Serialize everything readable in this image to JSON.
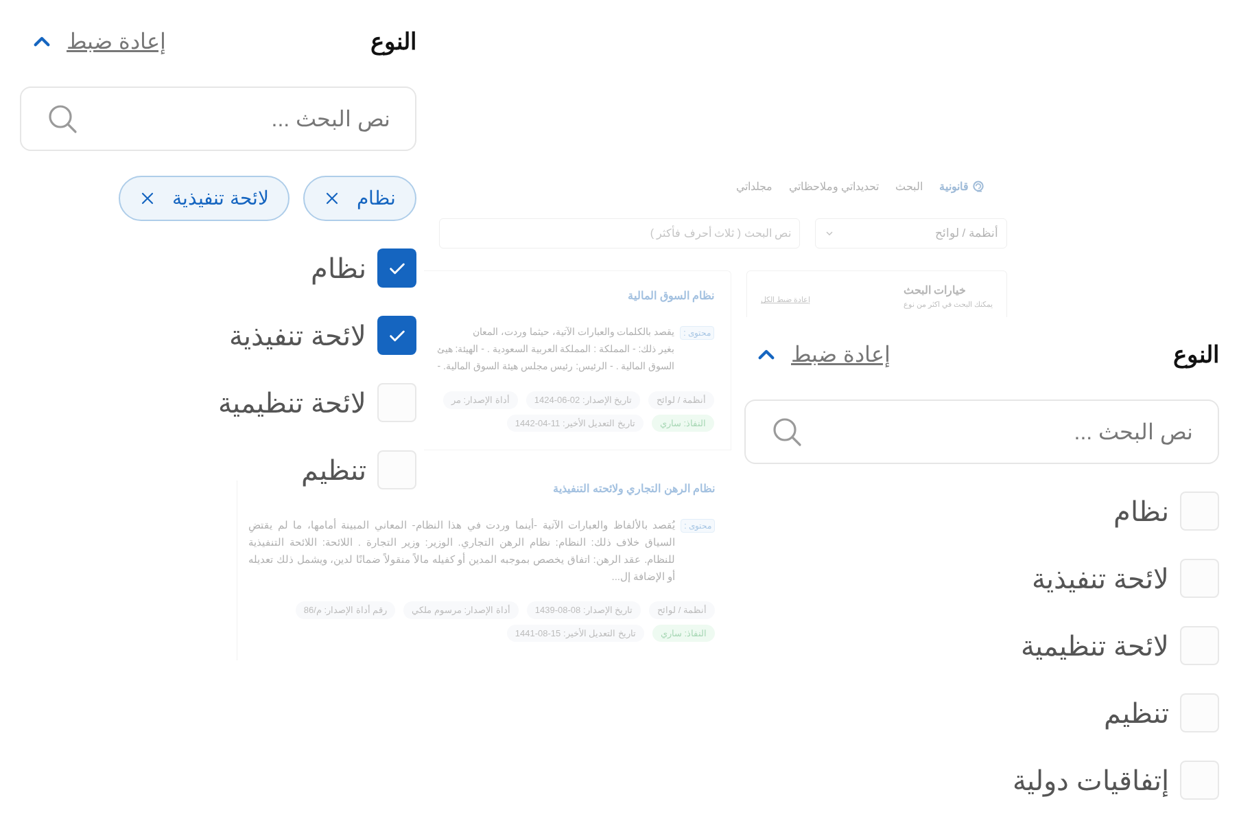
{
  "filter_panels": [
    {
      "title": "النوع",
      "reset_label": "إعادة ضبط",
      "search_placeholder": "نص البحث ...",
      "chips": [
        {
          "label": "نظام"
        },
        {
          "label": "لائحة تنفيذية"
        }
      ],
      "options": [
        {
          "label": "نظام",
          "checked": true
        },
        {
          "label": "لائحة تنفيذية",
          "checked": true
        },
        {
          "label": "لائحة تنظيمية",
          "checked": false
        },
        {
          "label": "تنظيم",
          "checked": false
        }
      ]
    },
    {
      "title": "النوع",
      "reset_label": "إعادة ضبط",
      "search_placeholder": "نص البحث ...",
      "options": [
        {
          "label": "نظام",
          "checked": false
        },
        {
          "label": "لائحة تنفيذية",
          "checked": false
        },
        {
          "label": "لائحة تنظيمية",
          "checked": false
        },
        {
          "label": "تنظيم",
          "checked": false
        },
        {
          "label": "إتفاقيات دولية",
          "checked": false
        }
      ]
    }
  ],
  "background_page": {
    "logo_text": "قانونية",
    "nav": [
      "البحث",
      "تحديداتي وملاحظاتي",
      "مجلداتي"
    ],
    "type_select": "أنظمة / لوائح",
    "search_placeholder": "نص البحث ( ثلاث أحرف فأكثر )",
    "options_card": {
      "title": "خيارات البحث",
      "subtitle": "يمكنك البحث في اكثر من نوع",
      "reset": "إعادة ضبط الكل"
    },
    "results": [
      {
        "title": "نظام السوق المالية",
        "content_label": "محتوى :",
        "excerpt_lines": [
          "يقصد بالكلمات والعبارات الآتية، حيثما وردت، المعان",
          "بغير ذلك: - المملكة : المملكة العربية السعودية . - الهيئة: هيئ",
          "السوق المالية . - الرئيس: رئيس مجلس هيئة السوق المالية. -"
        ],
        "tag_rows": [
          [
            {
              "label": "أنظمة / لوائح",
              "kind": "plain"
            },
            {
              "label": "تاريخ الإصدار: 02-06-1424",
              "kind": "plain"
            },
            {
              "label": "أداة الإصدار: مر",
              "kind": "plain"
            }
          ],
          [
            {
              "label": "النفاذ: ساري",
              "kind": "status"
            },
            {
              "label": "تاريخ التعديل الأخير: 11-04-1442",
              "kind": "plain"
            }
          ]
        ]
      },
      {
        "title": "نظام الرهن التجاري ولائحته التنفيذية",
        "content_label": "محتوى :",
        "excerpt_lines": [
          "يُقصد بالألفاظ والعبارات الآتية -أينما وردت في هذا النظام- المعاني المبينة أمامها، ما لم يقتضِ السياق خلاف ذلك: النظام: نظام الرهن التجاري. الوزير: وزير التجارة . اللائحة: اللائحة التنفيذية للنظام. عقد الرهن: اتفاق يخصص بموجبه المدين أو كفيله مالاً منقولاً ضمانًا لدين، ويشمل ذلك تعديله أو الإضافة إل..."
        ],
        "tag_rows": [
          [
            {
              "label": "أنظمة / لوائح",
              "kind": "plain"
            },
            {
              "label": "تاريخ الإصدار: 08-08-1439",
              "kind": "plain"
            },
            {
              "label": "أداة الإصدار: مرسوم ملكي",
              "kind": "plain"
            },
            {
              "label": "رقم أداة الإصدار: م/86",
              "kind": "plain"
            }
          ],
          [
            {
              "label": "النفاذ: ساري",
              "kind": "status"
            },
            {
              "label": "تاريخ التعديل الأخير: 15-08-1441",
              "kind": "plain"
            }
          ]
        ]
      }
    ]
  }
}
